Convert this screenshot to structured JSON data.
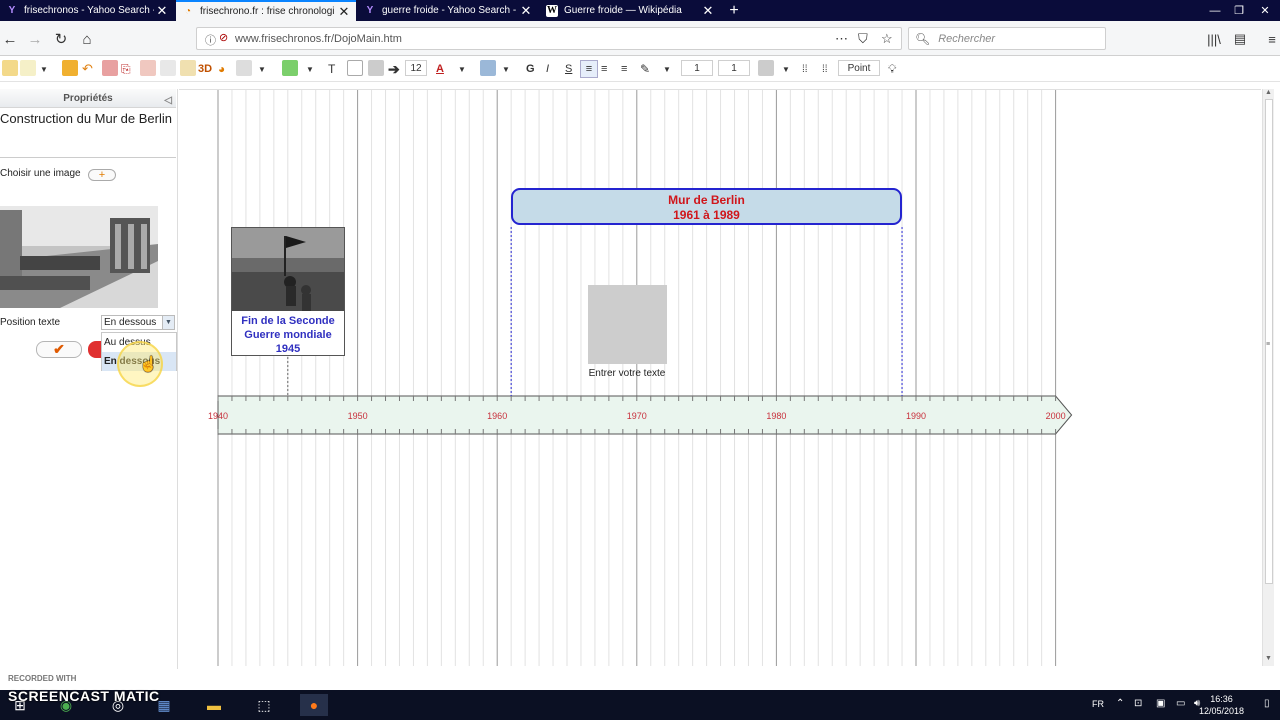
{
  "tabs": [
    {
      "title": "frisechronos - Yahoo Search - A",
      "icon": "yahoo-icon",
      "active": false
    },
    {
      "title": "frisechrono.fr : frise chronologi",
      "icon": "frisechrono-icon",
      "active": true
    },
    {
      "title": "guerre froide - Yahoo Search -",
      "icon": "yahoo-icon",
      "active": false
    },
    {
      "title": "Guerre froide — Wikipédia",
      "icon": "wikipedia-icon",
      "active": false
    }
  ],
  "nav": {
    "url": "www.frisechronos.fr/DojoMain.htm",
    "search_placeholder": "Rechercher"
  },
  "toolbar": {
    "font_size": "12",
    "bold": "G",
    "italic": "I",
    "underline": "S",
    "line_width_1": "1",
    "line_width_2": "1",
    "unit": "Point",
    "label_3d": "3D"
  },
  "panel": {
    "header": "Propriétés",
    "title_value": "Construction du Mur de Berlin",
    "choose_image_label": "Choisir une image",
    "add_button": "+",
    "position_label": "Position texte",
    "position_value": "En dessous",
    "ok_button": "✔",
    "options": [
      "Au dessus",
      "En dessous"
    ]
  },
  "timeline": {
    "years": [
      "1940",
      "1950",
      "1960",
      "1970",
      "1980",
      "1990",
      "2000"
    ],
    "axis_color": "#c8303c",
    "band_color": "#eaf5ee"
  },
  "events": {
    "ww2_end": {
      "line1": "Fin de la Seconde",
      "line2": "Guerre mondiale",
      "line3": "1945"
    },
    "berlin_wall": {
      "title": "Mur de Berlin",
      "dates": "1961 à 1989"
    },
    "placeholder_text": "Entrer votre texte"
  },
  "watermark": {
    "line1": "RECORDED WITH",
    "line2": "SCREENCAST MATIC"
  },
  "taskbar": {
    "lang": "FR",
    "time": "16:36",
    "date": "12/05/2018"
  },
  "colors": {
    "tabbar": "#0a0c3a",
    "event_text": "#3030c0",
    "period_text": "#d0161b",
    "period_fill": "#c5dbe8",
    "period_border": "#2424d0"
  }
}
